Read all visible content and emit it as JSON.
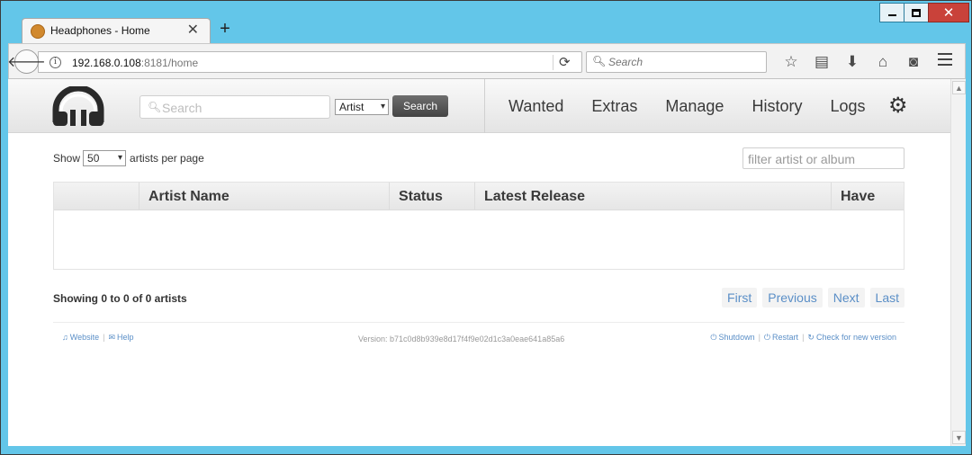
{
  "browser": {
    "tab_title": "Headphones - Home",
    "tab_close": "✕",
    "new_tab": "+",
    "url_host": "192.168.0.108",
    "url_rest": ":8181/home",
    "search_placeholder": "Search",
    "window_close": "✕"
  },
  "app": {
    "search_placeholder": "Search",
    "search_type": "Artist",
    "search_button": "Search",
    "nav": [
      "Wanted",
      "Extras",
      "Manage",
      "History",
      "Logs"
    ]
  },
  "list": {
    "show_label": "Show",
    "per_page_value": "50",
    "per_page_suffix": "artists per page",
    "filter_placeholder": "filter artist or album",
    "columns": [
      "Artist Name",
      "Status",
      "Latest Release",
      "Have"
    ],
    "showing": "Showing 0 to 0 of 0 artists",
    "pager": [
      "First",
      "Previous",
      "Next",
      "Last"
    ]
  },
  "footer": {
    "website": "Website",
    "help": "Help",
    "version": "Version: b71c0d8b939e8d17f4f9e02d1c3a0eae641a85a6",
    "shutdown": "Shutdown",
    "restart": "Restart",
    "check": "Check for new version"
  },
  "colors": {
    "titlebar": "#63c6e9",
    "link": "#5b8fc7",
    "close_button": "#c9423a"
  }
}
